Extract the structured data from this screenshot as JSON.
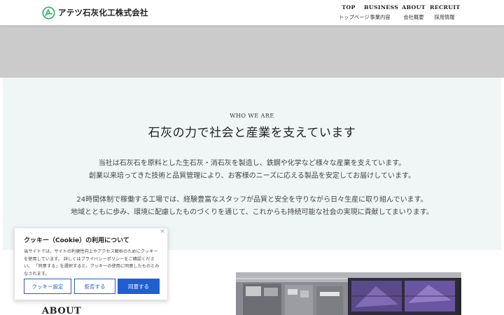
{
  "header": {
    "logo_text": "アテツ石灰化工株式会社",
    "nav": [
      {
        "en": "TOP",
        "jp": "トップページ"
      },
      {
        "en": "BUSINESS",
        "jp": "事業内容"
      },
      {
        "en": "ABOUT",
        "jp": "会社概要"
      },
      {
        "en": "RECRUIT",
        "jp": "採用情報"
      }
    ]
  },
  "intro": {
    "eyebrow": "WHO WE ARE",
    "title": "石灰の力で社会と産業を支えています",
    "lines": [
      "当社は石灰石を原料とした生石灰・消石灰を製造し、鉄鋼や化学など様々な産業を支えています。",
      "創業以来培ってきた技術と品質管理により、お客様のニーズに応える製品を安定してお届けしています。",
      "24時間体制で稼働する工場では、経験豊富なスタッフが品質と安全を守りながら日々生産に取り組んでいます。",
      "地域とともに歩み、環境に配慮したものづくりを通じて、これからも持続可能な社会の実現に貢献してまいります。"
    ]
  },
  "about": {
    "heading": "ABOUT"
  },
  "cookie": {
    "title": "クッキー（Cookie）の利用について",
    "body": "当サイトでは、サイトの利便性向上やアクセス解析のためにクッキーを使用しています。 詳しくはプライバシーポリシーをご確認ください。 「同意する」を選択すると、クッキーの使用に同意したものとみなされます。",
    "btn_settings": "クッキー設定",
    "btn_reject": "拒否する",
    "btn_accept": "同意する",
    "close": "×"
  },
  "colors": {
    "accent": "#1f5fd3",
    "logo_green": "#2fb36b",
    "hero_grey": "#cbcbcb",
    "section_bg": "#f0f5f6"
  }
}
